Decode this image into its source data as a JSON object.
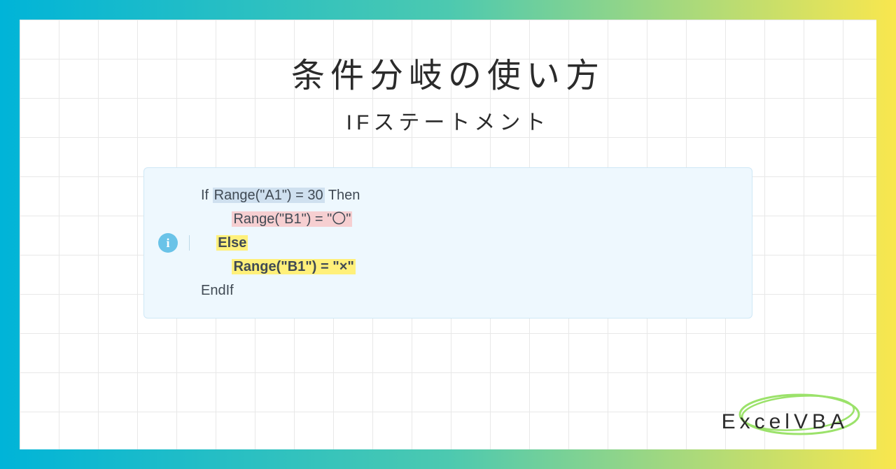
{
  "title": "条件分岐の使い方",
  "subtitle_if": "IF",
  "subtitle_rest": "ステートメント",
  "info_icon": "i",
  "code": {
    "l1_pre": "If ",
    "l1_hl": "Range(\"A1\") = 30",
    "l1_post": " Then",
    "l2_indent": "        ",
    "l2_hl": "Range(\"B1\") = \"〇\"",
    "l3_indent": "    ",
    "l3_hl": "Else",
    "l4_indent": "        ",
    "l4_hl": "Range(\"B1\") = \"×\"",
    "l5": "EndIf"
  },
  "logo": "ExcelVBA"
}
